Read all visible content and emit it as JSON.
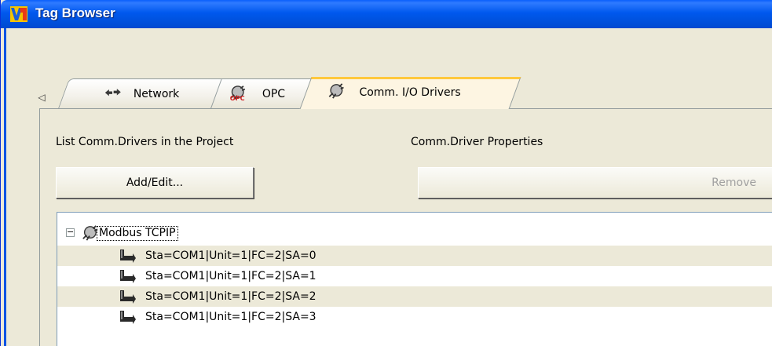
{
  "window": {
    "title": "Tag Browser"
  },
  "tabs": {
    "scroll_left": "◁",
    "items": [
      {
        "label": "Network",
        "icon": "network-arrows-icon"
      },
      {
        "label": "OPC",
        "icon": "opc-plug-icon"
      },
      {
        "label": "Comm. I/O Drivers",
        "icon": "comm-driver-plug-icon",
        "active": true
      }
    ]
  },
  "panel": {
    "list_label": "List Comm.Drivers in the Project",
    "properties_label": "Comm.Driver Properties",
    "add_edit_label": "Add/Edit...",
    "remove_label": "Remove"
  },
  "tree": {
    "root": {
      "label": "Modbus TCPIP",
      "expander": "−",
      "icon": "comm-driver-plug-icon"
    },
    "children": [
      {
        "label": "Sta=COM1|Unit=1|FC=2|SA=0",
        "icon": "tag-station-icon"
      },
      {
        "label": "Sta=COM1|Unit=1|FC=2|SA=1",
        "icon": "tag-station-icon"
      },
      {
        "label": "Sta=COM1|Unit=1|FC=2|SA=2",
        "icon": "tag-station-icon"
      },
      {
        "label": "Sta=COM1|Unit=1|FC=2|SA=3",
        "icon": "tag-station-icon"
      }
    ]
  },
  "colors": {
    "titlebar": "#0055e5",
    "active_tab_accent": "#ffc83c",
    "window_bg": "#ece9d8"
  }
}
